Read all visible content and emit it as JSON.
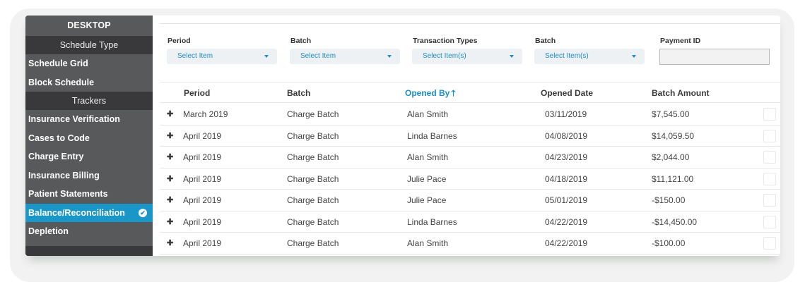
{
  "sidebar": {
    "header": "DESKTOP",
    "sections": [
      {
        "title": "Schedule Type",
        "items": [
          {
            "label": "Schedule Grid"
          },
          {
            "label": "Block Schedule"
          }
        ]
      },
      {
        "title": "Trackers",
        "items": [
          {
            "label": "Insurance Verification"
          },
          {
            "label": "Cases to Code"
          },
          {
            "label": "Charge Entry"
          },
          {
            "label": "Insurance Billing"
          },
          {
            "label": "Patient Statements"
          },
          {
            "label": "Balance/Reconciliation",
            "active": true
          },
          {
            "label": "Depletion"
          }
        ]
      }
    ],
    "active_icon": "check-circle-icon"
  },
  "filters": {
    "period": {
      "label": "Period",
      "value": "Select Item"
    },
    "batch1": {
      "label": "Batch",
      "value": "Select Item"
    },
    "transaction_types": {
      "label": "Transaction Types",
      "value": "Select Item(s)"
    },
    "batch2": {
      "label": "Batch",
      "value": "Select Item(s)"
    },
    "payment_id": {
      "label": "Payment ID",
      "value": ""
    }
  },
  "table": {
    "columns": [
      "Period",
      "Batch",
      "Opened By",
      "Opened Date",
      "Batch Amount"
    ],
    "sorted_column": "Opened By",
    "sort_icon": "arrow-up-icon",
    "row_icon": "plus-icon",
    "rows": [
      {
        "period": "March 2019",
        "batch": "Charge Batch",
        "opened_by": "Alan Smith",
        "opened_date": "03/11/2019",
        "amount": "$7,545.00"
      },
      {
        "period": "April 2019",
        "batch": "Charge Batch",
        "opened_by": "Linda Barnes",
        "opened_date": "04/08/2019",
        "amount": "$14,059.50"
      },
      {
        "period": "April 2019",
        "batch": "Charge Batch",
        "opened_by": "Alan Smith",
        "opened_date": "04/23/2019",
        "amount": "$2,044.00"
      },
      {
        "period": "April 2019",
        "batch": "Charge Batch",
        "opened_by": "Julie Pace",
        "opened_date": "04/18/2019",
        "amount": "$11,121.00"
      },
      {
        "period": "April 2019",
        "batch": "Charge Batch",
        "opened_by": "Julie Pace",
        "opened_date": "05/01/2019",
        "amount": "-$150.00"
      },
      {
        "period": "April 2019",
        "batch": "Charge Batch",
        "opened_by": "Linda Barnes",
        "opened_date": "04/22/2019",
        "amount": "-$14,450.00"
      },
      {
        "period": "April 2019",
        "batch": "Charge Batch",
        "opened_by": "Alan Smith",
        "opened_date": "04/22/2019",
        "amount": "-$100.00"
      }
    ]
  },
  "colors": {
    "accent": "#1a97c8",
    "sidebar": "#58595b",
    "sidebar_dark": "#39393b"
  }
}
